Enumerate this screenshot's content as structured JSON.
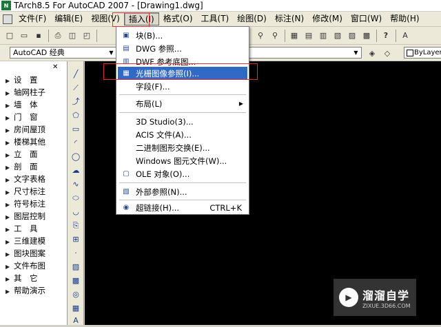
{
  "window": {
    "title": "TArch8.5 For AutoCAD 2007 - [Drawing1.dwg]",
    "logo_text": "N"
  },
  "menubar": {
    "items": [
      "文件(F)",
      "编辑(E)",
      "视图(V)",
      "插入(I)",
      "格式(O)",
      "工具(T)",
      "绘图(D)",
      "标注(N)",
      "修改(M)",
      "窗口(W)",
      "帮助(H)"
    ],
    "active_index": 3
  },
  "toolbar": {
    "style_value": "AutoCAD 经典",
    "bylayer_value": "ByLayer"
  },
  "tarch_panel": {
    "items": [
      "设　置",
      "轴网柱子",
      "墙　体",
      "门　窗",
      "房间屋顶",
      "楼梯其他",
      "立　面",
      "剖　面",
      "文字表格",
      "尺寸标注",
      "符号标注",
      "图层控制",
      "工　具",
      "三维建模",
      "图块图案",
      "文件布图",
      "其　它",
      "帮助演示"
    ]
  },
  "insert_menu": {
    "items": [
      {
        "label": "块(B)...",
        "icon": "block-icon",
        "glyph": "▣"
      },
      {
        "label": "DWG 参照...",
        "icon": "dwg-reference-icon",
        "glyph": "▤"
      },
      {
        "label": "DWF 参考底图...",
        "icon": "dwf-underlay-icon",
        "glyph": "▥"
      },
      {
        "label": "光栅图像参照(I)...",
        "icon": "raster-image-icon",
        "glyph": "▦",
        "selected": true
      },
      {
        "label": "字段(F)...",
        "icon": "field-icon",
        "glyph": ""
      },
      {
        "label": "布局(L)",
        "icon": "layout-icon",
        "glyph": "",
        "submenu": true
      },
      {
        "label": "3D Studio(3)...",
        "icon": "3ds-icon",
        "glyph": ""
      },
      {
        "label": "ACIS 文件(A)...",
        "icon": "acis-icon",
        "glyph": ""
      },
      {
        "label": "二进制图形交换(E)...",
        "icon": "dxb-icon",
        "glyph": ""
      },
      {
        "label": "Windows 图元文件(W)...",
        "icon": "wmf-icon",
        "glyph": ""
      },
      {
        "label": "OLE 对象(O)...",
        "icon": "ole-object-icon",
        "glyph": "▢"
      },
      {
        "label": "外部参照(N)...",
        "icon": "xref-icon",
        "glyph": "▧"
      },
      {
        "label": "超链接(H)...",
        "icon": "hyperlink-icon",
        "glyph": "◉",
        "shortcut": "CTRL+K"
      }
    ]
  },
  "watermark": {
    "title": "溜溜自学",
    "url": "ZIXUE.3D66.COM"
  },
  "colors": {
    "selection": "#316ac5",
    "canvas": "#000000",
    "highlight_box": "#e03030"
  }
}
